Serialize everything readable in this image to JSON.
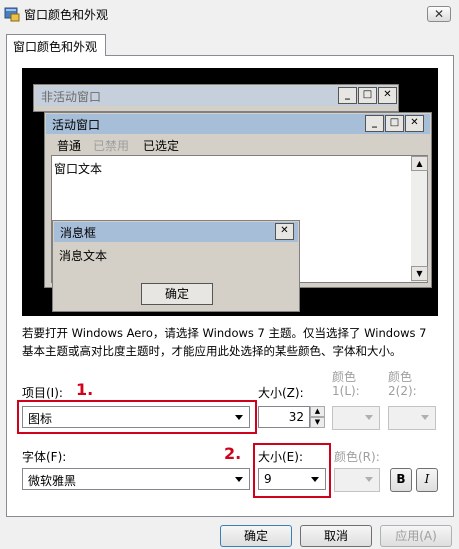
{
  "window": {
    "title": "窗口颜色和外观",
    "close_label": "✕"
  },
  "tab": {
    "label": "窗口颜色和外观"
  },
  "preview": {
    "inactive_window_title": "非活动窗口",
    "active_window_title": "活动窗口",
    "menu": [
      "普通",
      "已禁用",
      "已选定"
    ],
    "window_text": "窗口文本",
    "message_box_title": "消息框",
    "message_text": "消息文本",
    "ok_label": "确定"
  },
  "note": "若要打开 Windows Aero，请选择 Windows 7 主题。仅当选择了 Windows 7 基本主题或高对比度主题时，才能应用此处选择的某些颜色、字体和大小。",
  "item": {
    "label": "项目(I):",
    "value": "图标",
    "annotation": "1."
  },
  "item_size": {
    "label": "大小(Z):",
    "value": "32"
  },
  "color1": {
    "label_top": "颜色",
    "label_bottom": "1(L):"
  },
  "color2": {
    "label_top": "颜色",
    "label_bottom": "2(2):"
  },
  "font": {
    "label": "字体(F):",
    "value": "微软雅黑"
  },
  "font_size": {
    "label": "大小(E):",
    "value": "9",
    "annotation": "2."
  },
  "font_color": {
    "label": "颜色(R):"
  },
  "bold_label": "B",
  "italic_label": "I",
  "buttons": {
    "ok": "确定",
    "cancel": "取消",
    "apply": "应用(A)"
  },
  "colors": {
    "annotation_red": "#d0021b",
    "active_title": "#a7bed8"
  }
}
